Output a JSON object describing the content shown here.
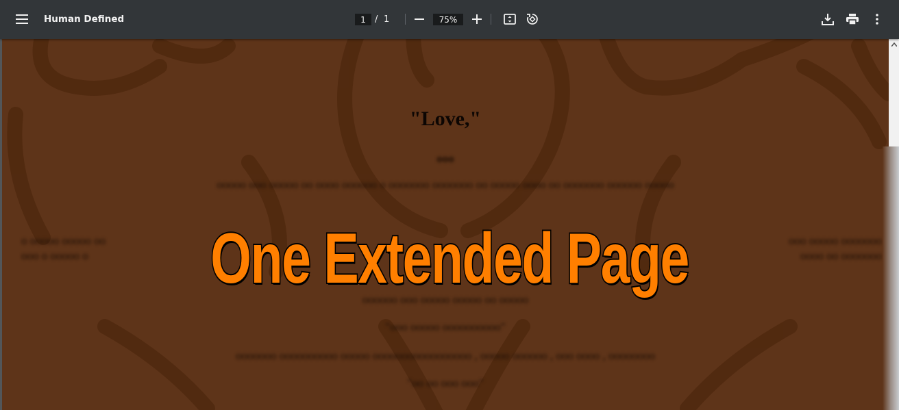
{
  "toolbar": {
    "menu_icon": "hamburger-menu-icon",
    "title": "Human Defined",
    "page_current": "1",
    "page_separator": "/",
    "page_total": "1",
    "zoom": "75%",
    "icons": [
      "minus-icon",
      "plus-icon",
      "fit-to-page-icon",
      "rotate-icon",
      "download-icon",
      "print-icon",
      "more-vert-icon"
    ]
  },
  "document": {
    "heading": "\"Love,\"",
    "background_color": "#5e3419"
  },
  "overlay": {
    "text": "One Extended Page",
    "color": "#ff7f00"
  },
  "colors": {
    "toolbar_bg": "#323639",
    "viewer_bg": "#525659"
  }
}
